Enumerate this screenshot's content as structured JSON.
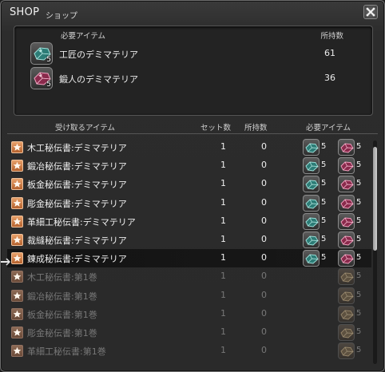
{
  "window": {
    "title": "SHOP",
    "subtitle": "ショップ"
  },
  "required": {
    "header_item": "必要アイテム",
    "header_owned": "所持数",
    "items": [
      {
        "name": "工匠のデミマテリア",
        "qty": "5",
        "owned": "61",
        "icon": "teal-materia-icon"
      },
      {
        "name": "鍛人のデミマテリア",
        "qty": "5",
        "owned": "36",
        "icon": "magenta-materia-icon"
      }
    ]
  },
  "list": {
    "headers": {
      "receive": "受け取るアイテム",
      "sets": "セット数",
      "owned": "所持数",
      "required": "必要アイテム"
    },
    "rows": [
      {
        "name": "木工秘伝書:デミマテリア",
        "sets": "1",
        "owned": "0",
        "cost1": "5",
        "cost2": "5",
        "dim": false
      },
      {
        "name": "鍛冶秘伝書:デミマテリア",
        "sets": "1",
        "owned": "0",
        "cost1": "5",
        "cost2": "5",
        "dim": false
      },
      {
        "name": "板金秘伝書:デミマテリア",
        "sets": "1",
        "owned": "0",
        "cost1": "5",
        "cost2": "5",
        "dim": false
      },
      {
        "name": "彫金秘伝書:デミマテリア",
        "sets": "1",
        "owned": "0",
        "cost1": "5",
        "cost2": "5",
        "dim": false
      },
      {
        "name": "革細工秘伝書:デミマテリア",
        "sets": "1",
        "owned": "0",
        "cost1": "5",
        "cost2": "5",
        "dim": false
      },
      {
        "name": "裁縫秘伝書:デミマテリア",
        "sets": "1",
        "owned": "0",
        "cost1": "5",
        "cost2": "5",
        "dim": false
      },
      {
        "name": "錬成秘伝書:デミマテリア",
        "sets": "1",
        "owned": "0",
        "cost1": "5",
        "cost2": "5",
        "dim": false
      },
      {
        "name": "木工秘伝書:第1巻",
        "sets": "1",
        "owned": "0",
        "cost1": "",
        "cost2": "5",
        "dim": true
      },
      {
        "name": "鍛冶秘伝書:第1巻",
        "sets": "1",
        "owned": "0",
        "cost1": "",
        "cost2": "5",
        "dim": true
      },
      {
        "name": "板金秘伝書:第1巻",
        "sets": "1",
        "owned": "0",
        "cost1": "",
        "cost2": "5",
        "dim": true
      },
      {
        "name": "彫金秘伝書:第1巻",
        "sets": "1",
        "owned": "0",
        "cost1": "",
        "cost2": "5",
        "dim": true
      },
      {
        "name": "革細工秘伝書:第1巻",
        "sets": "1",
        "owned": "0",
        "cost1": "",
        "cost2": "5",
        "dim": true
      }
    ],
    "selected_index": 6
  },
  "colors": {
    "accent_star": "#d27a40",
    "teal_gem": "#3fb3a8",
    "magenta_gem": "#c0406a",
    "bronze_gem": "#a08a6a"
  }
}
